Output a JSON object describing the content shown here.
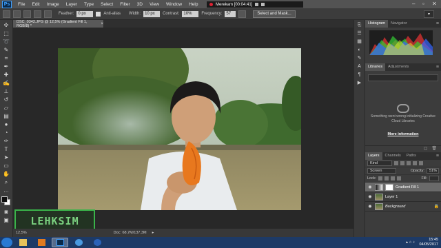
{
  "menubar": {
    "logo": "Ps",
    "items": [
      "File",
      "Edit",
      "Image",
      "Layer",
      "Type",
      "Select",
      "Filter",
      "3D",
      "View",
      "Window",
      "Help"
    ],
    "recorder": "Merekam [00:04:41]"
  },
  "options": {
    "feather_label": "Feather:",
    "feather_value": "0 px",
    "antialias_label": "Anti-alias",
    "width_label": "Width:",
    "width_value": "10 px",
    "contrast_label": "Contrast:",
    "contrast_value": "10%",
    "frequency_label": "Frequency:",
    "frequency_value": "57",
    "select_mask_label": "Select and Mask..."
  },
  "document": {
    "tab_title": "DSC_0342.JPG @ 12,5% (Gradient Fill 1, RGB/8) *",
    "zoom": "12,5%",
    "doc_size": "Doc: 68,7M/137,3M",
    "watermark": "LEHKSIM"
  },
  "panels": {
    "histogram_tab": "Histogram",
    "navigator_tab": "Navigator",
    "libraries_tab": "Libraries",
    "adjustments_tab": "Adjustments",
    "libraries_message": "Something went wrong initializing Creative Cloud Libraries",
    "libraries_link": "More information",
    "layers_tab": "Layers",
    "channels_tab": "Channels",
    "paths_tab": "Paths",
    "kind_label": "Kind",
    "blend_mode": "Screen",
    "opacity_label": "Opacity:",
    "opacity_value": "51%",
    "lock_label": "Lock:",
    "fill_label": "Fill:",
    "layers": [
      {
        "name": "Gradient Fill 1",
        "active": true
      },
      {
        "name": "Layer 1",
        "active": false
      },
      {
        "name": "Background",
        "active": false
      }
    ]
  },
  "taskbar": {
    "time": "15:45",
    "date": "04/05/2017"
  },
  "colors": {
    "accent": "#3fa0ff",
    "watermark_green": "#3ab34a",
    "taskbar": "#1d3a66"
  }
}
